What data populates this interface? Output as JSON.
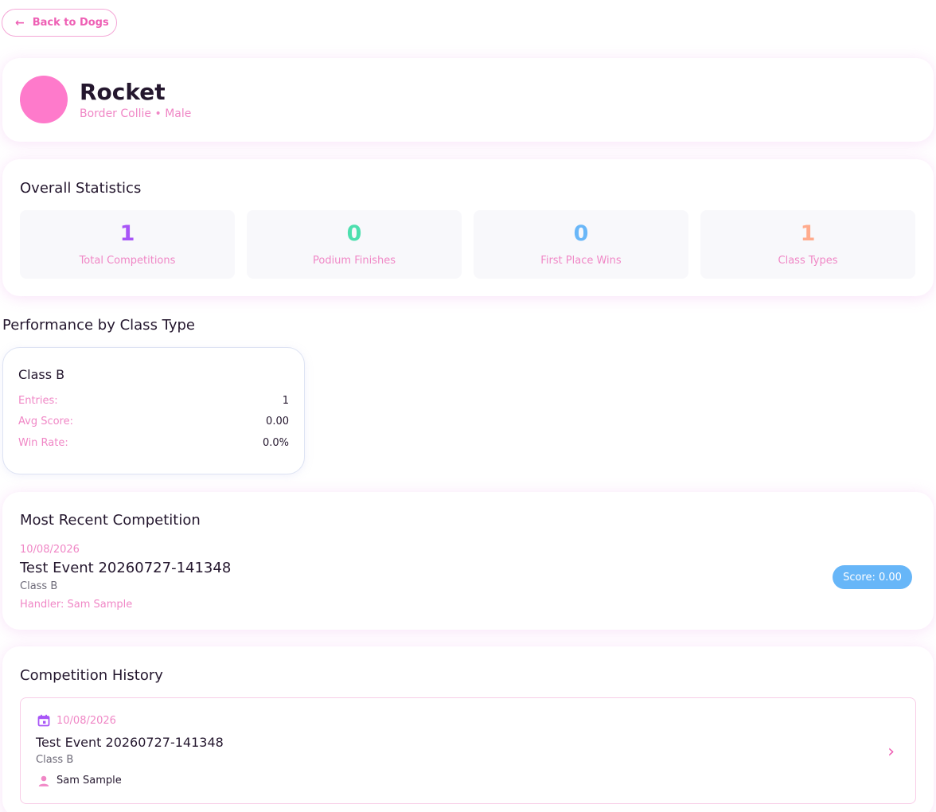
{
  "nav": {
    "back_label": "Back to Dogs",
    "back_icon": "arrow-left-icon"
  },
  "profile": {
    "name": "Rocket",
    "breed": "Border Collie",
    "separator": "•",
    "sex": "Male",
    "avatar_color": "#fe7acb"
  },
  "overall": {
    "title": "Overall Statistics",
    "stats": [
      {
        "value": "1",
        "label": "Total Competitions",
        "color": "#a855f7"
      },
      {
        "value": "0",
        "label": "Podium Finishes",
        "color": "#4ddfae"
      },
      {
        "value": "0",
        "label": "First Place Wins",
        "color": "#6ab7f8"
      },
      {
        "value": "1",
        "label": "Class Types",
        "color": "#ffab8d"
      }
    ]
  },
  "performance": {
    "title": "Performance by Class Type",
    "classes": [
      {
        "name": "Class B",
        "entries_label": "Entries:",
        "entries": "1",
        "avg_label": "Avg Score:",
        "avg": "0.00",
        "win_label": "Win Rate:",
        "win": "0.0%"
      }
    ]
  },
  "recent": {
    "title": "Most Recent Competition",
    "date": "10/08/2026",
    "event": "Test Event 20260727-141348",
    "class": "Class B",
    "handler": "Handler: Sam Sample",
    "score": "Score: 0.00",
    "score_color": "#67b6f8"
  },
  "history": {
    "title": "Competition History",
    "items": [
      {
        "date": "10/08/2026",
        "event": "Test Event 20260727-141348",
        "class": "Class B",
        "handler": "Sam Sample"
      }
    ]
  },
  "colors": {
    "accent_pink": "#ee5fb4",
    "label_pink": "#f087c6",
    "calendar_icon": "#a855f7",
    "person_icon": "#f087c6"
  }
}
